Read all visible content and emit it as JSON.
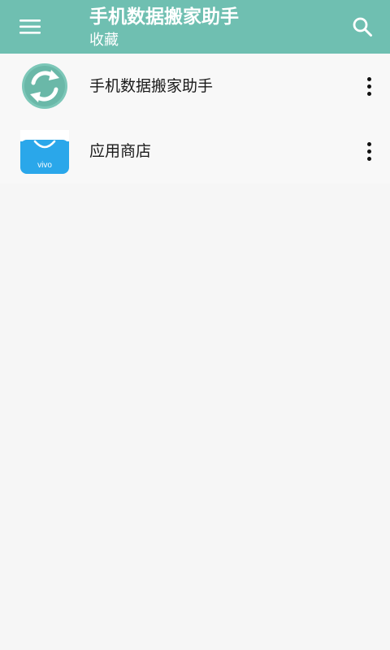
{
  "header": {
    "title": "手机数据搬家助手",
    "subtitle": "收藏",
    "background_color": "#6fbfb1",
    "menu_icon": "hamburger-menu-icon",
    "search_icon": "search-icon"
  },
  "list": {
    "items": [
      {
        "label": "手机数据搬家助手",
        "icon": "data-transfer-app-icon"
      },
      {
        "label": "应用商店",
        "icon": "vivo-app-store-icon",
        "icon_text": "vivo"
      }
    ]
  }
}
